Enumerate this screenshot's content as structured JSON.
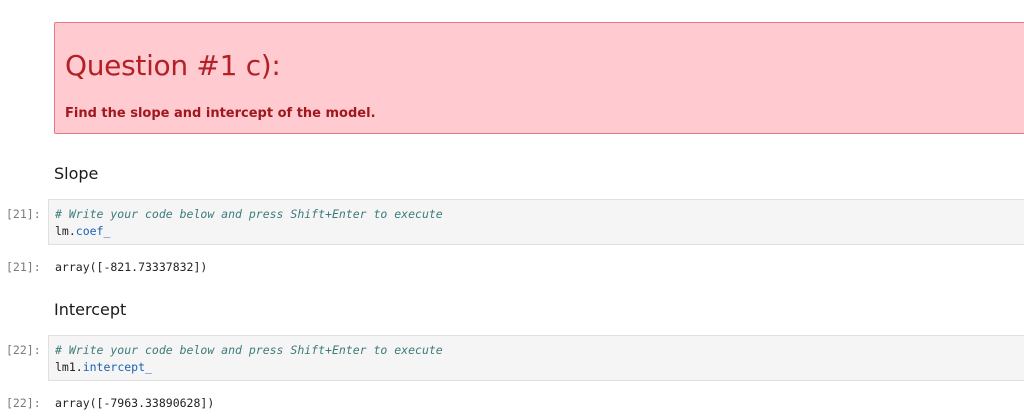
{
  "alert": {
    "title": "Question #1 c):",
    "text": "Find the slope and intercept of the model."
  },
  "sections": {
    "slope": {
      "heading": "Slope",
      "input_prompt": "[21]:",
      "comment": "# Write your code below and press Shift+Enter to execute",
      "code_object": "lm.",
      "code_attr": "coef_",
      "output_prompt": "[21]:",
      "output": "array([-821.73337832])"
    },
    "intercept": {
      "heading": "Intercept",
      "input_prompt": "[22]:",
      "comment": "# Write your code below and press Shift+Enter to execute",
      "code_object": "lm1.",
      "code_attr": "intercept_",
      "output_prompt": "[22]:",
      "output": "array([-7963.33890628])"
    }
  },
  "colors": {
    "alert_background": "#ffcbd0",
    "alert_border": "#e57a86",
    "alert_text": "#b32025",
    "code_background": "#f5f5f5",
    "comment": "#3d7b7b",
    "attribute": "#1a5fb4",
    "prompt": "#7a7a7a"
  }
}
